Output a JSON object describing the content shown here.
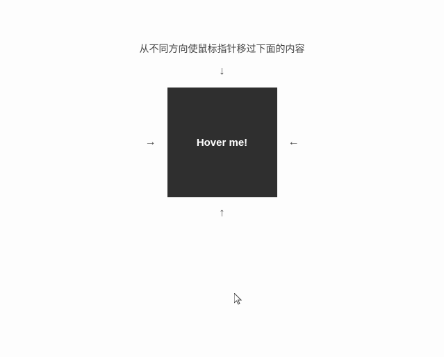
{
  "instruction": "从不同方向使鼠标指针移过下面的内容",
  "arrows": {
    "top": "↓",
    "left": "→",
    "right": "←",
    "bottom": "↑"
  },
  "hover_box": {
    "label": "Hover me!"
  }
}
